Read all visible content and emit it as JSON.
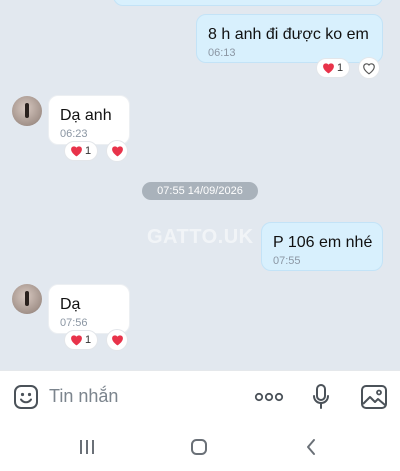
{
  "chat": {
    "watermark": "GATTO.UK",
    "date_separator": "07:55 14/09/2026",
    "messages": [
      {
        "direction": "out",
        "text": "8 h anh đi được ko em",
        "time": "06:13",
        "reaction_count": "1"
      },
      {
        "direction": "in",
        "text": "Dạ anh",
        "time": "06:23",
        "reaction_count": "1"
      },
      {
        "direction": "out",
        "text": "P 106 em nhé",
        "time": "07:55"
      },
      {
        "direction": "in",
        "text": "Dạ",
        "time": "07:56",
        "reaction_count": "1"
      }
    ]
  },
  "input": {
    "placeholder": "Tin nhắn"
  },
  "icons": {
    "sticker": "sticker-icon",
    "more": "more-icon",
    "mic": "microphone-icon",
    "image": "image-icon",
    "recents": "recent-apps-icon",
    "home": "home-icon",
    "back": "back-icon"
  },
  "colors": {
    "heart": "#e8334a",
    "outgoing_bubble": "#d8f0fd",
    "incoming_bubble": "#ffffff",
    "background": "#e2e8ef"
  }
}
